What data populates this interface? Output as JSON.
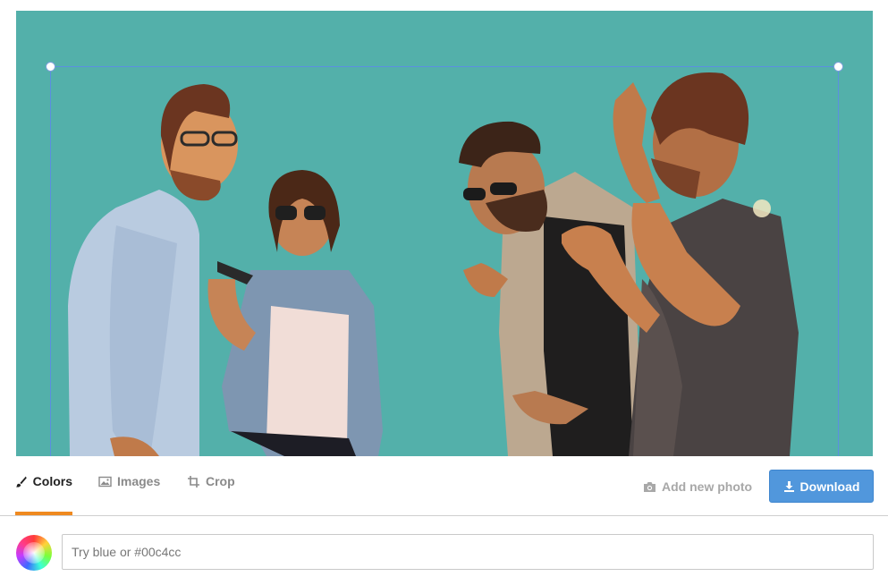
{
  "editor": {
    "background_color": "#53b0aa",
    "crop_border_color": "#5b8fe0"
  },
  "tabs": [
    {
      "label": "Colors",
      "icon": "brush-icon",
      "active": true
    },
    {
      "label": "Images",
      "icon": "image-icon",
      "active": false
    },
    {
      "label": "Crop",
      "icon": "crop-icon",
      "active": false
    }
  ],
  "actions": {
    "add_photo_label": "Add new photo",
    "add_photo_icon": "camera-icon",
    "download_label": "Download",
    "download_icon": "download-icon",
    "download_color": "#5197dc"
  },
  "accent_color": "#ef8a20",
  "color_input": {
    "placeholder": "Try blue or #00c4cc",
    "value": ""
  }
}
